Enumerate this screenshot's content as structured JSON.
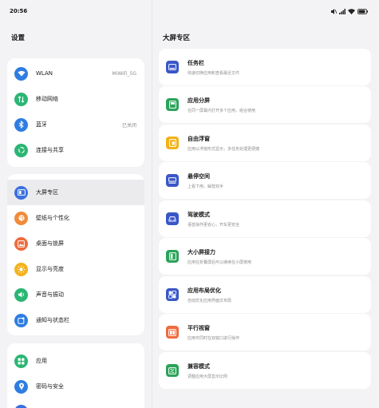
{
  "status_bar": {
    "time": "20:56"
  },
  "left_panel": {
    "title": "设置",
    "groups": [
      {
        "items": [
          {
            "label": "WLAN",
            "value": "MiWiFi_5G",
            "icon": "wifi-icon",
            "color": "#2f7de1"
          },
          {
            "label": "移动网络",
            "value": "",
            "icon": "mobile-network-icon",
            "color": "#2bb673"
          },
          {
            "label": "蓝牙",
            "value": "已关闭",
            "icon": "bluetooth-icon",
            "color": "#2f7de1"
          },
          {
            "label": "连接与共享",
            "value": "",
            "icon": "connection-share-icon",
            "color": "#2bb673"
          }
        ]
      },
      {
        "items": [
          {
            "label": "大屏专区",
            "value": "",
            "icon": "large-screen-icon",
            "color": "#3a6fe0",
            "selected": true
          },
          {
            "label": "壁纸与个性化",
            "value": "",
            "icon": "wallpaper-icon",
            "color": "#f08b3a"
          },
          {
            "label": "桌面与锁屏",
            "value": "",
            "icon": "desktop-lockscreen-icon",
            "color": "#ef6b3d"
          },
          {
            "label": "显示与亮度",
            "value": "",
            "icon": "brightness-icon",
            "color": "#f3b21e"
          },
          {
            "label": "声音与振动",
            "value": "",
            "icon": "sound-icon",
            "color": "#2bb673"
          },
          {
            "label": "通知与状态栏",
            "value": "",
            "icon": "notification-icon",
            "color": "#2f7de1"
          }
        ]
      },
      {
        "items": [
          {
            "label": "应用",
            "value": "",
            "icon": "apps-icon",
            "color": "#2bb673"
          },
          {
            "label": "密码与安全",
            "value": "",
            "icon": "security-icon",
            "color": "#2f7de1"
          }
        ]
      }
    ]
  },
  "right_panel": {
    "title": "大屏专区",
    "items": [
      {
        "title": "任务栏",
        "subtitle": "快速切换应用和查看最近文件",
        "icon": "taskbar-icon",
        "color": "#3a57c8"
      },
      {
        "title": "应用分屏",
        "subtitle": "在同一屏幕内打开多个应用，组合使用",
        "icon": "split-screen-icon",
        "color": "#2aa35a"
      },
      {
        "title": "自由浮窗",
        "subtitle": "应用以浮窗形式显示，多任务处理更便捷",
        "icon": "floating-window-icon",
        "color": "#f2b118"
      },
      {
        "title": "悬停空间",
        "subtitle": "上看下用，解放双手",
        "icon": "hover-space-icon",
        "color": "#3a57c8"
      },
      {
        "title": "驾驶模式",
        "subtitle": "语音操作更省心，开车更安全",
        "icon": "driving-mode-icon",
        "color": "#3a57c8"
      },
      {
        "title": "大小屏接力",
        "subtitle": "应用在折叠屏后可以继续在小屏使用",
        "icon": "screen-relay-icon",
        "color": "#2aa35a"
      },
      {
        "title": "应用布局优化",
        "subtitle": "自动优化应用界面文布局",
        "icon": "layout-optimize-icon",
        "color": "#3a57c8"
      },
      {
        "title": "平行视窗",
        "subtitle": "应用可同时在双窗口进行操作",
        "icon": "parallel-window-icon",
        "color": "#ef6b3d"
      },
      {
        "title": "兼容模式",
        "subtitle": "调整应用大屏显示比例",
        "icon": "compat-mode-icon",
        "color": "#2aa35a"
      }
    ]
  }
}
